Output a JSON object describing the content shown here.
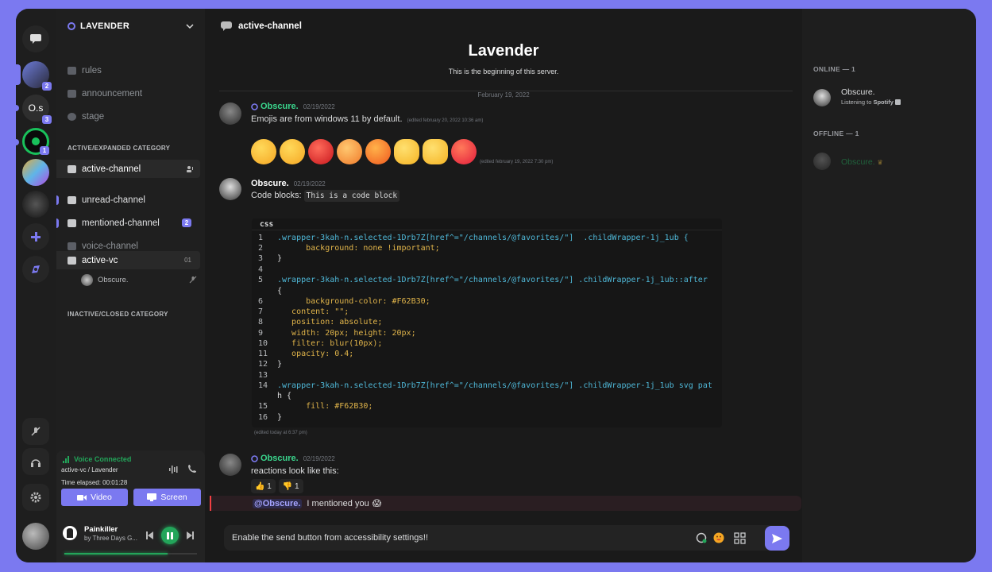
{
  "server": {
    "name": "LAVENDER"
  },
  "rail": {
    "servers": [
      {
        "label": "",
        "badge": "2"
      },
      {
        "label": "O.s",
        "badge": "3"
      },
      {
        "label": "",
        "badge": "1"
      }
    ]
  },
  "channels": {
    "top": [
      {
        "name": "rules",
        "icon": "rules-icon"
      },
      {
        "name": "announcement",
        "icon": "announcement-icon"
      },
      {
        "name": "stage",
        "icon": "stage-icon"
      }
    ],
    "category_active": "ACTIVE/EXPANDED CATEGORY",
    "active_channel": "active-channel",
    "unread_channel": "unread-channel",
    "mentioned_channel": "mentioned-channel",
    "mentioned_badge": "2",
    "voice_channel": "voice-channel",
    "active_vc": "active-vc",
    "active_vc_count": "01",
    "vc_member": "Obscure.",
    "category_inactive": "INACTIVE/CLOSED CATEGORY"
  },
  "voice": {
    "status": "Voice Connected",
    "location": "active-vc / Lavender",
    "elapsed": "Time elapsed: 00:01:28",
    "video_label": "Video",
    "screen_label": "Screen"
  },
  "player": {
    "title": "Painkiller",
    "artist": "by Three Days G...",
    "progress": 0.78
  },
  "header": {
    "channel": "active-channel"
  },
  "welcome": {
    "title": "Lavender",
    "subtitle": "This is the beginning of this server."
  },
  "divider_date": "February 19, 2022",
  "messages": [
    {
      "author": "Obscure.",
      "time": "02/19/2022",
      "text": "Emojis are from windows 11 by default.",
      "edited": "(edited february 20, 2022 10:36 am)",
      "emoji_edited": "(edited february 19, 2022 7:30 pm)"
    },
    {
      "author": "Obscure.",
      "time": "02/19/2022",
      "text": "Code blocks:",
      "code_inline": "This is a code block"
    },
    {
      "author": "Obscure.",
      "time": "02/19/2022",
      "text": "reactions look like this:"
    }
  ],
  "emojis": [
    "rolling-laughing",
    "joy",
    "rage",
    "angry",
    "hand-over-mouth",
    "ok-hand",
    "thumbs-up",
    "hot-face"
  ],
  "code": {
    "lang": "css",
    "edited": "(edited today at 6:37 pm)",
    "lines": [
      ".wrapper-3kah-n.selected-1Drb7Z[href^=\"/channels/@favorites/\"]  .childWrapper-1j_1ub {",
      "      background: none !important;",
      "}",
      "",
      ".wrapper-3kah-n.selected-1Drb7Z[href^=\"/channels/@favorites/\"] .childWrapper-1j_1ub::after",
      "{",
      "      background-color: #F62B30;",
      "   content: \"\";",
      "   position: absolute;",
      "   width: 20px; height: 20px;",
      "   filter: blur(10px);",
      "   opacity: 0.4;",
      "}",
      "",
      ".wrapper-3kah-n.selected-1Drb7Z[href^=\"/channels/@favorites/\"] .childWrapper-1j_1ub svg pat",
      "h {",
      "      fill: #F62B30;",
      "}"
    ],
    "numbers": [
      "1",
      "2",
      "3",
      "4",
      "5",
      "",
      "6",
      "7",
      "8",
      "9",
      "10",
      "11",
      "12",
      "13",
      "14",
      "",
      "15",
      "16"
    ]
  },
  "reactions": [
    {
      "emoji": "👍",
      "count": "1"
    },
    {
      "emoji": "👎",
      "count": "1"
    }
  ],
  "mention": {
    "user": "@Obscure.",
    "text": "I mentioned you",
    "emoji": "😱"
  },
  "composer": {
    "text": "Enable the send button from accessibility settings!!"
  },
  "members": {
    "online_header": "ONLINE — 1",
    "online_name": "Obscure.",
    "online_status": "Listening to",
    "online_status_app": "Spotify",
    "offline_header": "OFFLINE — 1",
    "offline_name": "Obscure."
  },
  "colors": {
    "accent": "#7b79f0",
    "green": "#23a55a",
    "mention": "#f23f42"
  }
}
